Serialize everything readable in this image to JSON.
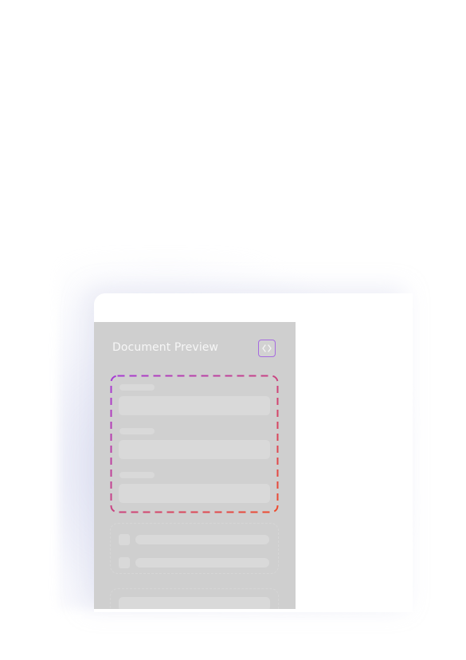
{
  "panel": {
    "title": "Document Preview"
  },
  "icons": {
    "code_toggle": "code-brackets-icon"
  },
  "colors": {
    "panel_bg": "#cfcfcf",
    "skeleton": "#d9d9d9",
    "focus_gradient_start": "#a63bd6",
    "focus_gradient_end": "#ee4b2b",
    "code_button_border": "#a66ae0"
  },
  "sections": {
    "form_fields_count": 3,
    "checkbox_rows_count": 2
  }
}
